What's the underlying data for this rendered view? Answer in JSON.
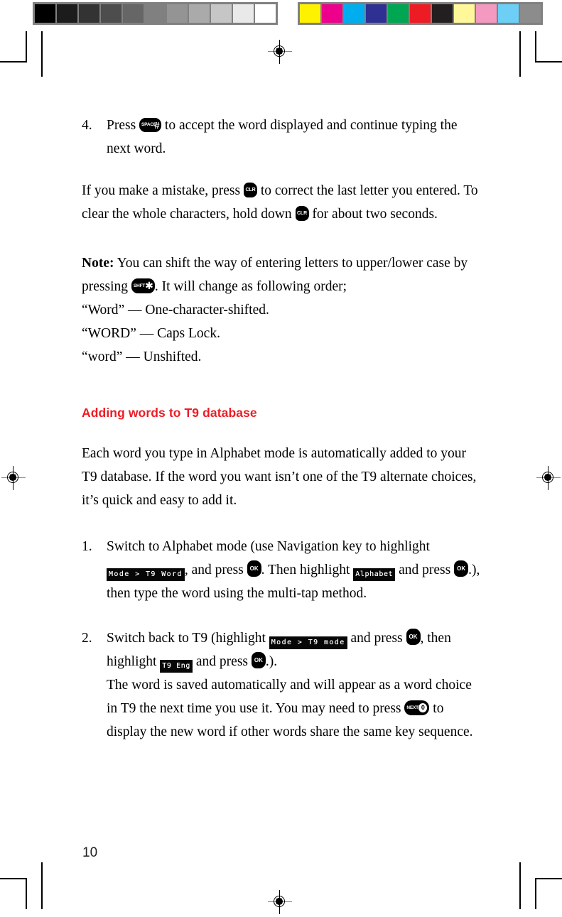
{
  "calibration": {
    "gray_bar": {
      "name": "grayscale-step-wedge",
      "patches": [
        "#000000",
        "#1c1c1c",
        "#333333",
        "#4d4d4d",
        "#666666",
        "#808080",
        "#949494",
        "#aaaaaa",
        "#c6c6c6",
        "#e9e9e9",
        "#ffffff"
      ]
    },
    "color_bar": {
      "name": "process-color-bar",
      "patches": [
        "#fff200",
        "#ec008c",
        "#00aeef",
        "#2e3192",
        "#00a651",
        "#ed1c24",
        "#231f20",
        "#fff799",
        "#f49ac1",
        "#6dcff6",
        "#8c8c8c"
      ]
    }
  },
  "document": {
    "page_number": "10",
    "accent_color": "#ED1C24"
  },
  "content": {
    "step4": {
      "number": "4.",
      "text_before": "Press",
      "key": {
        "name": "space-key",
        "label": "SPACE",
        "symbol": "#"
      },
      "text_after": "to accept the word displayed and continue typing the next word."
    },
    "mistake_paragraph": {
      "part1": "If you make a mistake, press",
      "key1": {
        "name": "clear-key",
        "label": "CLR"
      },
      "part2": "to correct the last letter you entered. To clear the whole characters, hold down",
      "key2": {
        "name": "clear-key",
        "label": "CLR"
      },
      "part3": "for about two seconds."
    },
    "note": {
      "label": "Note:",
      "part1": "You can shift the way of entering letters to upper/lower case by pressing",
      "key": {
        "name": "shift-key",
        "label": "SHFT",
        "symbol": "✱"
      },
      "part2": ". It will change as following order;",
      "lines": [
        "“Word” — One-character-shifted.",
        "“WORD” — Caps Lock.",
        "“word” — Unshifted."
      ]
    },
    "heading": "Adding words to T9 database",
    "intro_paragraph": "Each word you type in Alphabet mode is automatically added to your T9 database. If the word you want isn’t one of the T9 alternate choices, it’s quick and easy to add it.",
    "steps": [
      {
        "number": "1.",
        "part1": "Switch to Alphabet mode (use Navigation key to highlight",
        "lcd1": "Mode > T9 Word",
        "part2": ", and press",
        "key1": {
          "name": "ok-key",
          "label": "OK"
        },
        "part3": ". Then highlight",
        "lcd2": "Alphabet",
        "part4": "and press",
        "key2": {
          "name": "ok-key",
          "label": "OK"
        },
        "part5": ".), then type the word using the multi-tap method."
      },
      {
        "number": "2.",
        "part1": "Switch back to T9 (highlight",
        "lcd1": "Mode > T9 mode",
        "part2": "and press",
        "key1": {
          "name": "ok-key",
          "label": "OK"
        },
        "part3": ", then highlight",
        "lcd2": "T9 Eng",
        "part4": "and press",
        "key2": {
          "name": "ok-key",
          "label": "OK"
        },
        "part5": ".).",
        "trailing": "The word is saved automatically and will appear as a word choice in T9 the next time you use it. You may need to press",
        "key3": {
          "name": "next-key",
          "label": "NEXT",
          "digit": "0"
        },
        "trailing2": "to display the new word if other words share the same key sequence."
      }
    ]
  }
}
